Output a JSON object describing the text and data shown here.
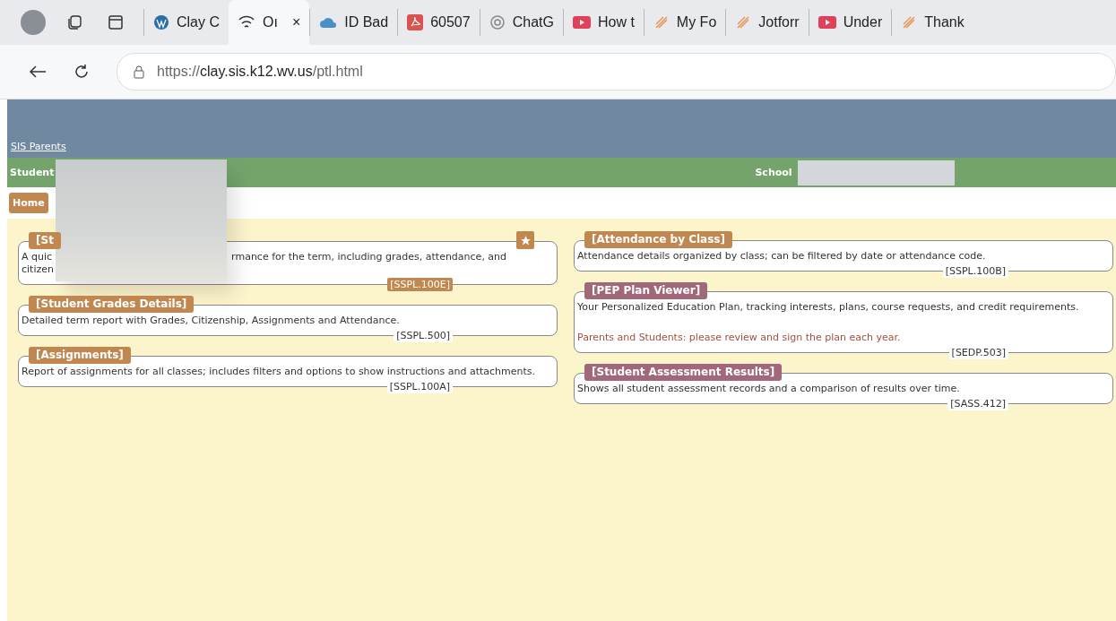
{
  "browser": {
    "tabs": [
      {
        "label": "Clay C",
        "selected": false
      },
      {
        "label": "Oı",
        "selected": true,
        "close": "×"
      },
      {
        "label": "ID Bad",
        "selected": false
      },
      {
        "label": "60507",
        "selected": false
      },
      {
        "label": "ChatG",
        "selected": false
      },
      {
        "label": "How t",
        "selected": false
      },
      {
        "label": "My Fo",
        "selected": false
      },
      {
        "label": "Jotforr",
        "selected": false
      },
      {
        "label": "Under",
        "selected": false
      },
      {
        "label": "Thank",
        "selected": false
      }
    ],
    "url_host": "https://clay.sis.k12.wv.us",
    "url_path": "/ptl.html"
  },
  "header": {
    "link": "SIS Parents",
    "student_label": "Student",
    "school_label": "School"
  },
  "nav": {
    "home": "Home"
  },
  "columns": [
    [
      {
        "title": "[St",
        "color": "#c08850",
        "starred": true,
        "lines": [
          [
            {
              "kind": "text",
              "text": "A quic"
            },
            {
              "kind": "hidden"
            },
            {
              "kind": "text",
              "text": "rmance for the term, including grades, attendance, and"
            }
          ],
          [
            {
              "kind": "text",
              "text": "citizen"
            }
          ]
        ],
        "code": "[SSPL.100E]",
        "code_highlighted": true
      },
      {
        "title": "[Student Grades Details]",
        "color": "#c08850",
        "starred": false,
        "lines": [
          [
            {
              "kind": "text",
              "text": "Detailed term report with Grades, Citizenship, Assignments and Attendance."
            }
          ]
        ],
        "code": "[SSPL.500]",
        "code_highlighted": false
      },
      {
        "title": "[Assignments]",
        "color": "#c08850",
        "starred": false,
        "lines": [
          [
            {
              "kind": "text",
              "text": "Report of assignments for all classes; includes filters and options to show instructions and attachments."
            }
          ]
        ],
        "code": "[SSPL.100A]",
        "code_highlighted": false
      }
    ],
    [
      {
        "title": "[Attendance by Class]",
        "color": "#c08850",
        "starred": false,
        "lines": [
          [
            {
              "kind": "text",
              "text": "Attendance details organized by class; can be filtered by date or attendance code."
            }
          ]
        ],
        "code": "[SSPL.100B]",
        "code_highlighted": false
      },
      {
        "title": "[PEP Plan Viewer]",
        "color": "#a06878",
        "starred": false,
        "lines": [
          [
            {
              "kind": "text",
              "text": "Your Personalized Education Plan, tracking interests, plans, course requests, and credit requirements."
            }
          ]
        ],
        "note": "Parents and Students: please review and sign the plan each year.",
        "code": "[SEDP.503]",
        "code_highlighted": false
      },
      {
        "title": "[Student Assessment Results]",
        "color": "#a06878",
        "starred": false,
        "lines": [
          [
            {
              "kind": "text",
              "text": "Shows all student assessment records and a comparison of results over time."
            }
          ]
        ],
        "code": "[SASS.412]",
        "code_highlighted": false
      }
    ]
  ]
}
